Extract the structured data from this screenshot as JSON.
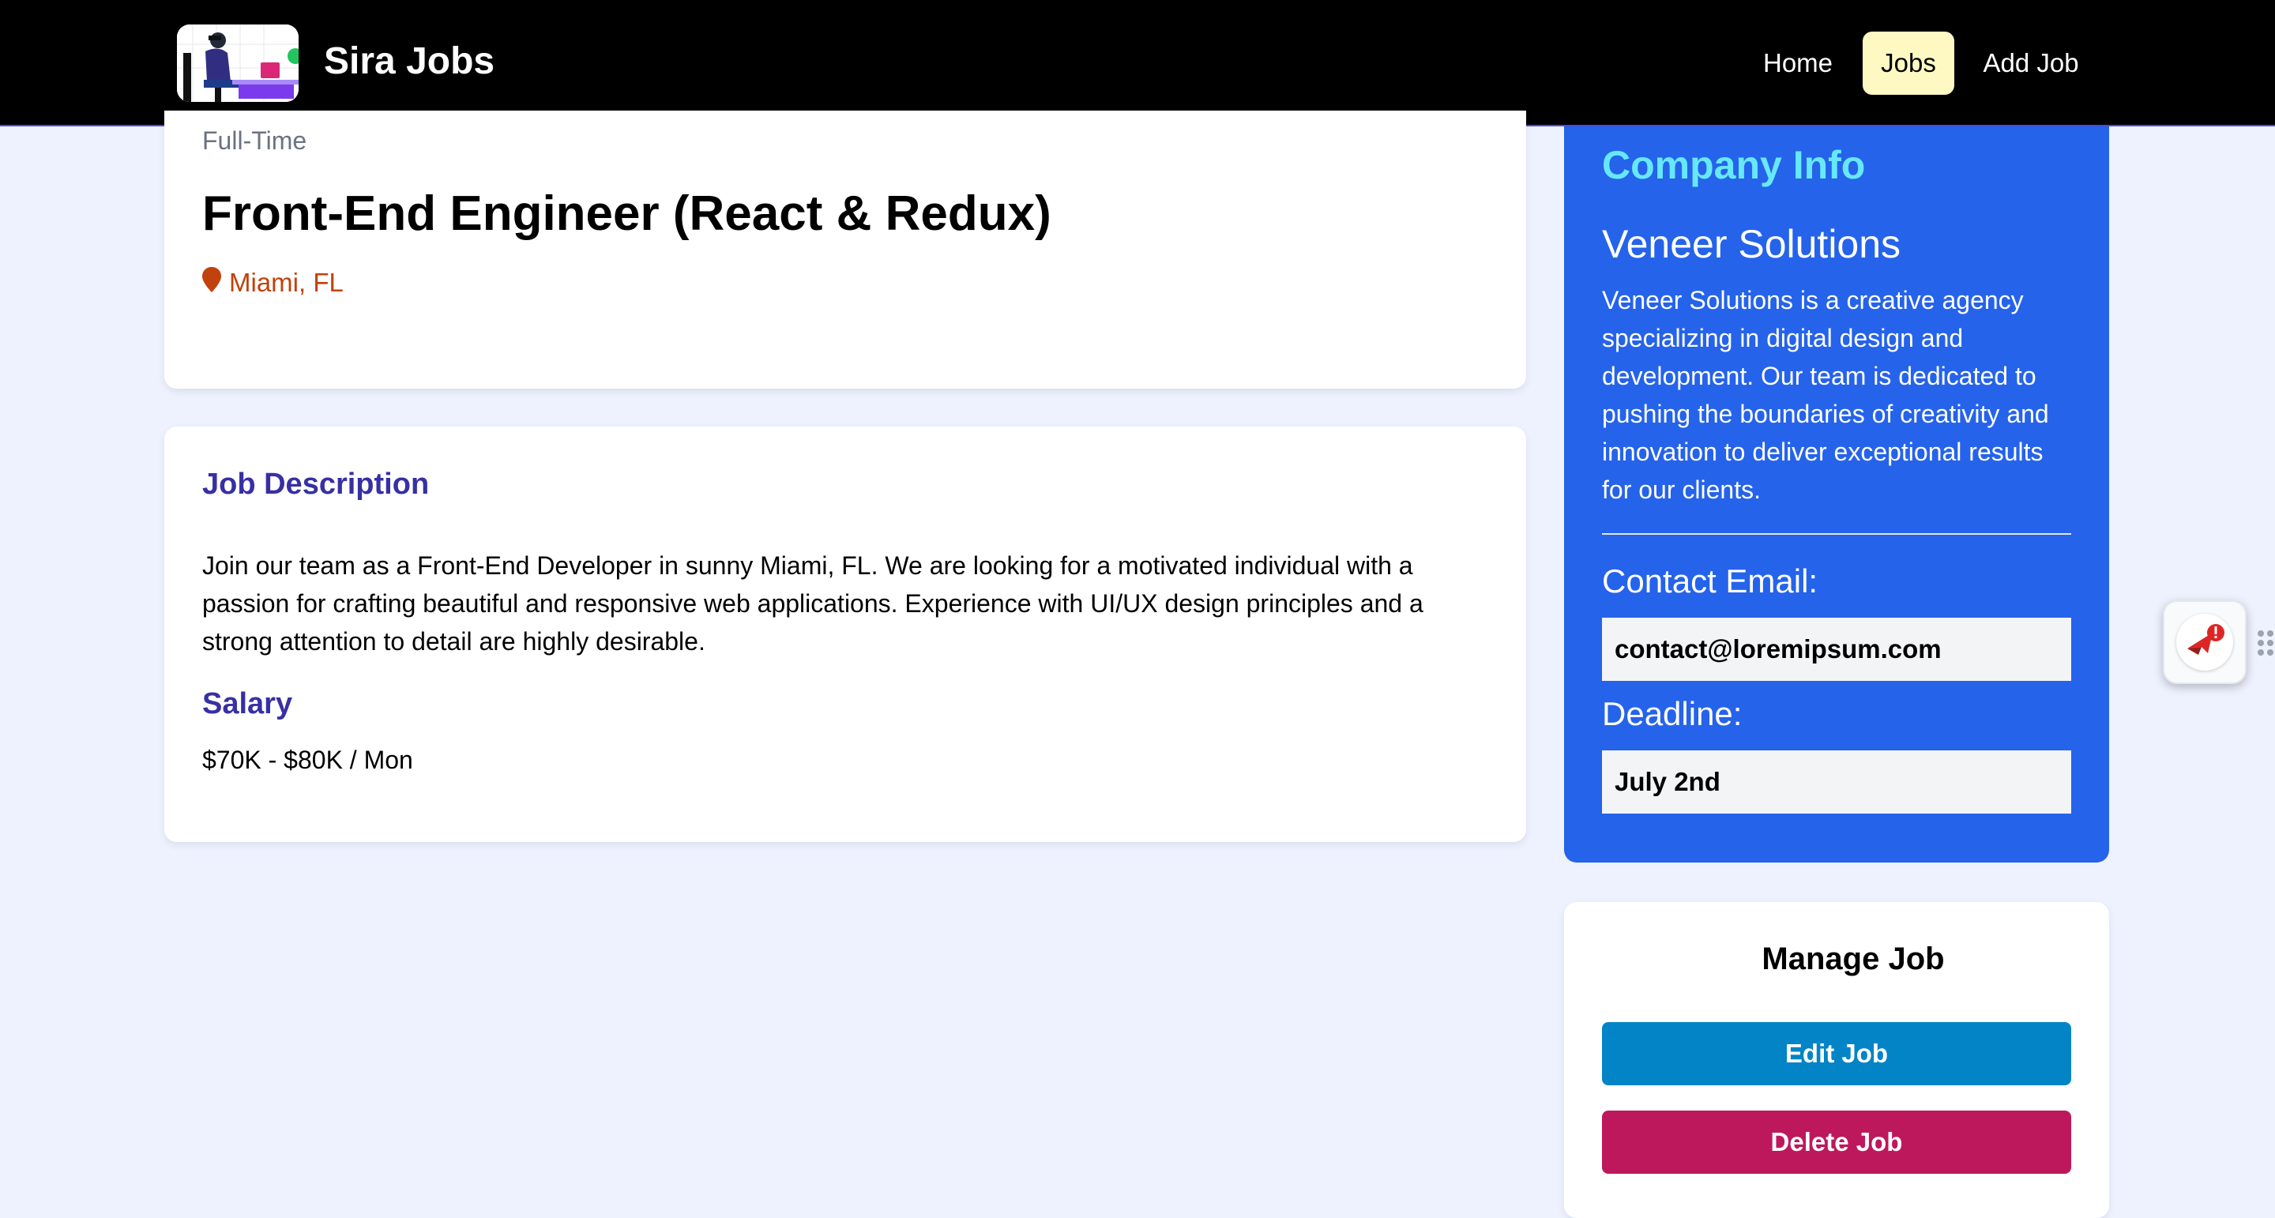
{
  "nav": {
    "brand": "Sira Jobs",
    "links": [
      {
        "label": "Home"
      },
      {
        "label": "Jobs",
        "active": true
      },
      {
        "label": "Add Job"
      }
    ]
  },
  "job": {
    "type": "Full-Time",
    "title": "Front-End Engineer (React & Redux)",
    "location": "Miami, FL",
    "description_heading": "Job Description",
    "description": "Join our team as a Front-End Developer in sunny Miami, FL. We are looking for a motivated individual with a passion for crafting beautiful and responsive web applications. Experience with UI/UX design principles and a strong attention to detail are highly desirable.",
    "salary_heading": "Salary",
    "salary": "$70K - $80K / Mon"
  },
  "company": {
    "heading": "Company Info",
    "name": "Veneer Solutions",
    "description": "Veneer Solutions is a creative agency specializing in digital design and development. Our team is dedicated to pushing the boundaries of creativity and innovation to deliver exceptional results for our clients.",
    "contact_label": "Contact Email:",
    "contact_email": "contact@loremipsum.com",
    "deadline_label": "Deadline:",
    "deadline": "July 2nd"
  },
  "manage": {
    "title": "Manage Job",
    "edit_label": "Edit Job",
    "delete_label": "Delete Job"
  },
  "colors": {
    "nav_bg": "#000000",
    "active_link_bg": "#fef9c3",
    "page_bg": "#eef2ff",
    "company_bg": "#2563eb",
    "company_heading": "#67e8f9",
    "section_heading": "#3730a3",
    "location": "#c2410c",
    "edit_button": "#0284c7",
    "delete_button": "#be185d"
  },
  "icons": {
    "logo": "person-at-laptop-illustration",
    "location": "map-pin-icon",
    "widget": "paper-plane-alert-icon",
    "handle": "drag-handle-icon"
  }
}
